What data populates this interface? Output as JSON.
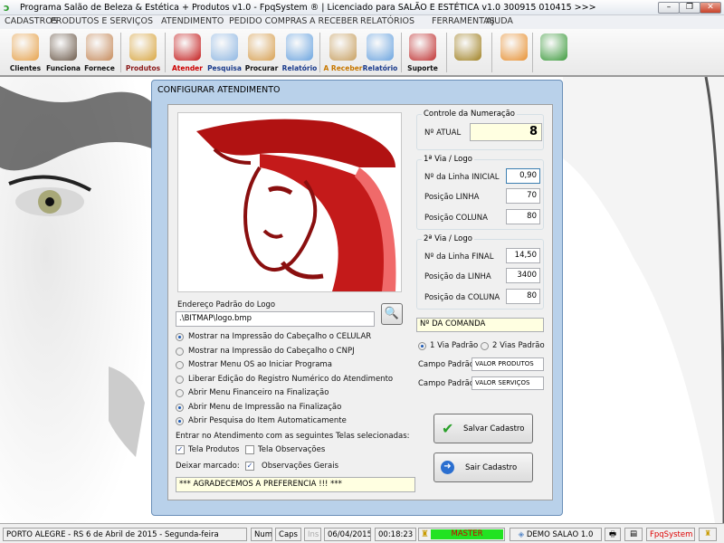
{
  "window": {
    "title": "Programa Salão de Beleza & Estética + Produtos v1.0 - FpqSystem ® | Licenciado para  SALÃO E ESTÉTICA v1.0 300915 010415 >>>",
    "minimize": "–",
    "restore": "❐",
    "close": "✕"
  },
  "menu": [
    "CADASTROS",
    "PRODUTOS E SERVIÇOS",
    "ATENDIMENTO",
    "PEDIDO COMPRAS",
    "A RECEBER",
    "RELATÓRIOS",
    "FERRAMENTAS",
    "AJUDA"
  ],
  "toolbar": [
    {
      "label": "Clientes",
      "icon": "clients-icon",
      "color": "#111"
    },
    {
      "label": "Funciona",
      "icon": "employees-icon",
      "color": "#111"
    },
    {
      "label": "Fornece",
      "icon": "supplier-icon",
      "color": "#111"
    },
    {
      "label": "Produtos",
      "icon": "boxes-icon",
      "color": "#8b1a1a"
    },
    {
      "label": "Atender",
      "icon": "woman-logo-icon",
      "color": "#c00"
    },
    {
      "label": "Pesquisa",
      "icon": "search-docs-icon",
      "color": "#1a3a8b"
    },
    {
      "label": "Procurar",
      "icon": "file-drawer-icon",
      "color": "#111"
    },
    {
      "label": "Relatório",
      "icon": "printer-icon",
      "color": "#1a3a8b"
    },
    {
      "label": "A Receber",
      "icon": "money-bag-icon",
      "color": "#c87800"
    },
    {
      "label": "Relatório",
      "icon": "printer-icon",
      "color": "#1a3a8b"
    },
    {
      "label": "Suporte",
      "icon": "support-headset-icon",
      "color": "#111"
    },
    {
      "label": "",
      "icon": "coin-icon",
      "color": "#111"
    },
    {
      "label": "",
      "icon": "calculator-icon",
      "color": "#111"
    },
    {
      "label": "",
      "icon": "exit-door-icon",
      "color": "#111"
    }
  ],
  "dialog": {
    "title": "CONFIGURAR ATENDIMENTO",
    "logo_label": "Endereço Padrão do Logo",
    "logo_path": ".\\BITMAP\\logo.bmp",
    "options": [
      {
        "label": "Mostrar na Impressão do Cabeçalho o CELULAR",
        "on": true
      },
      {
        "label": "Mostrar na Impressão do Cabeçalho o CNPJ",
        "on": false
      },
      {
        "label": "Mostrar Menu OS  ao Iniciar Programa",
        "on": false
      },
      {
        "label": "Liberar Edição do Registro Numérico do Atendimento",
        "on": false
      },
      {
        "label": "Abrir Menu Financeiro na Finalização",
        "on": false
      },
      {
        "label": "Abrir Menu de Impressão na Finalização",
        "on": true
      },
      {
        "label": "Abrir Pesquisa do Item Automaticamente",
        "on": true
      }
    ],
    "screens_label": "Entrar no Atendimento com as seguintes Telas selecionadas:",
    "chk_produtos": "Tela Produtos",
    "chk_obs": "Tela Observações",
    "keep_label": "Deixar marcado:",
    "chk_obs_gerais": "Observações Gerais",
    "footer_msg": "*** AGRADECEMOS A PREFERENCIA !!! ***",
    "numbering": {
      "title": "Controle da Numeração",
      "label": "Nº ATUAL",
      "value": "8"
    },
    "via1": {
      "title": "1ª Via / Logo",
      "rows": [
        {
          "label": "Nº da Linha INICIAL",
          "value": "0,90"
        },
        {
          "label": "Posição LINHA",
          "value": "70"
        },
        {
          "label": "Posição COLUNA",
          "value": "80"
        }
      ]
    },
    "via2": {
      "title": "2ª Via / Logo",
      "rows": [
        {
          "label": "Nº da Linha FINAL",
          "value": "14,50"
        },
        {
          "label": "Posição da LINHA",
          "value": "3400"
        },
        {
          "label": "Posição da COLUNA",
          "value": "80"
        }
      ]
    },
    "comanda": "Nº DA COMANDA",
    "via_1": "1 Via Padrão",
    "via_2": "2 Vias Padrão",
    "campo_label": "Campo Padrão",
    "campo1": "VALOR PRODUTOS",
    "campo2": "VALOR SERVIÇOS",
    "save": "Salvar Cadastro",
    "exit": "Sair Cadastro"
  },
  "status": {
    "location": "PORTO ALEGRE - RS  6 de Abril de 2015 - Segunda-feira",
    "num": "Num",
    "caps": "Caps",
    "ins": "Ins",
    "date": "06/04/2015",
    "time": "00:18:23",
    "user": "MASTER",
    "version": "DEMO SALAO 1.0",
    "brand": "FpqSystem",
    "user_color": "#22e322"
  }
}
